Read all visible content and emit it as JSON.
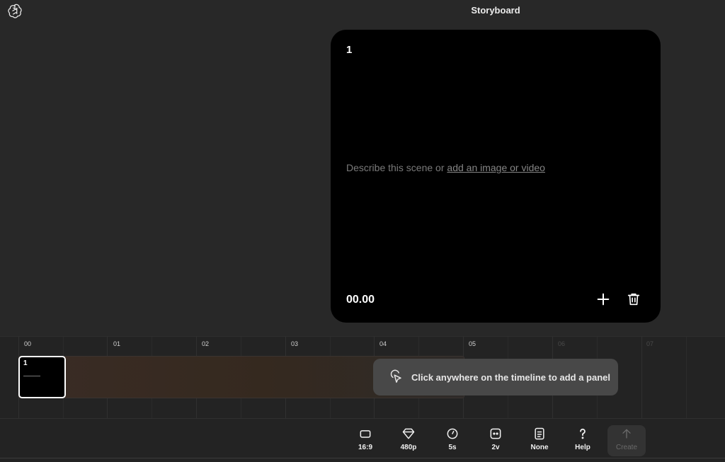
{
  "header": {
    "title": "Storyboard",
    "logo_icon": "openai-logo-icon"
  },
  "card": {
    "number": "1",
    "placeholder_prefix": "Describe this scene or ",
    "placeholder_link": "add an image or video",
    "timestamp": "00.00",
    "add_icon": "plus-icon",
    "delete_icon": "trash-icon"
  },
  "timeline": {
    "ticks": [
      "00",
      "01",
      "02",
      "03",
      "04",
      "05",
      "06",
      "07"
    ],
    "panel": {
      "number": "1"
    },
    "hint": "Click anywhere on the timeline to add a panel",
    "hint_icon": "pointer-click-icon"
  },
  "toolbar": {
    "items": [
      {
        "label": "16:9",
        "icon": "aspect-ratio-icon"
      },
      {
        "label": "480p",
        "icon": "diamond-icon"
      },
      {
        "label": "5s",
        "icon": "timer-icon"
      },
      {
        "label": "2v",
        "icon": "variations-icon"
      },
      {
        "label": "None",
        "icon": "preset-icon"
      },
      {
        "label": "Help",
        "icon": "question-icon"
      },
      {
        "label": "Create",
        "icon": "arrow-up-icon"
      }
    ]
  },
  "colors": {
    "background": "#282828",
    "card": "#000000",
    "track": "#3a2c25",
    "hint_bg": "#4a4a4a"
  }
}
